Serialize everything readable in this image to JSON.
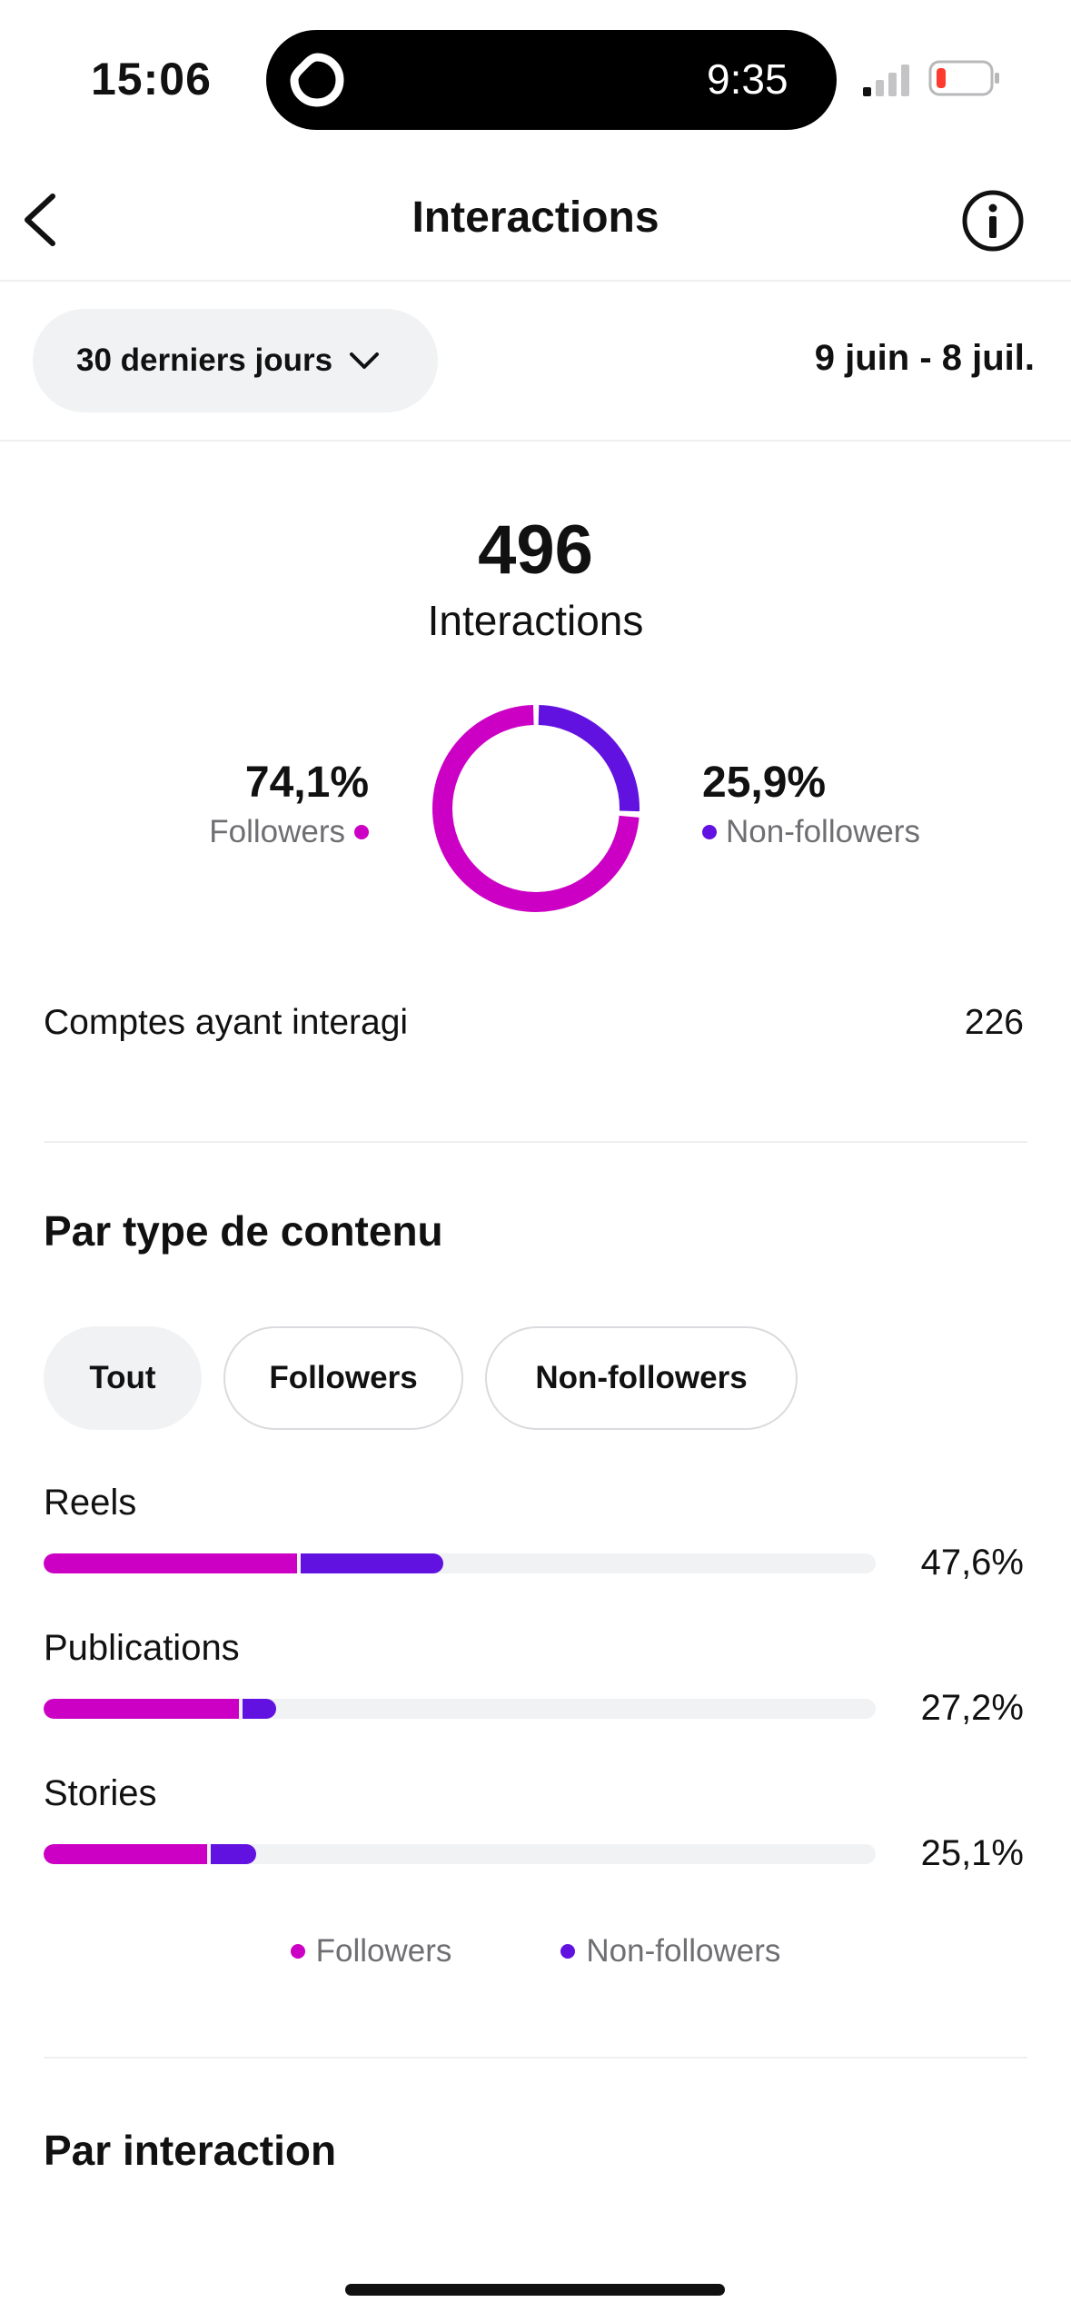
{
  "status_bar": {
    "time": "15:06",
    "island_time": "9:35"
  },
  "nav": {
    "title": "Interactions"
  },
  "filter": {
    "range_label": "30 derniers jours",
    "date_range": "9 juin - 8 juil."
  },
  "summary": {
    "total": "496",
    "total_label": "Interactions",
    "followers": {
      "percent": "74,1%",
      "label": "Followers",
      "value": 74.1
    },
    "non_followers": {
      "percent": "25,9%",
      "label": "Non-followers",
      "value": 25.9
    },
    "accounts_label": "Comptes ayant interagi",
    "accounts_value": "226"
  },
  "content_type": {
    "title": "Par type de contenu",
    "chips": [
      "Tout",
      "Followers",
      "Non-followers"
    ],
    "active_chip": "Tout",
    "rows": [
      {
        "label": "Reels",
        "value": "47,6%",
        "followers_share": 0.305,
        "non_followers_share": 0.175
      },
      {
        "label": "Publications",
        "value": "27,2%",
        "followers_share": 0.235,
        "non_followers_share": 0.045
      },
      {
        "label": "Stories",
        "value": "25,1%",
        "followers_share": 0.197,
        "non_followers_share": 0.058
      }
    ],
    "legend": [
      "Followers",
      "Non-followers"
    ]
  },
  "interaction_section": {
    "title": "Par interaction"
  },
  "colors": {
    "followers": "#cc00c4",
    "non_followers": "#6212e0",
    "track": "#f1f2f4"
  }
}
